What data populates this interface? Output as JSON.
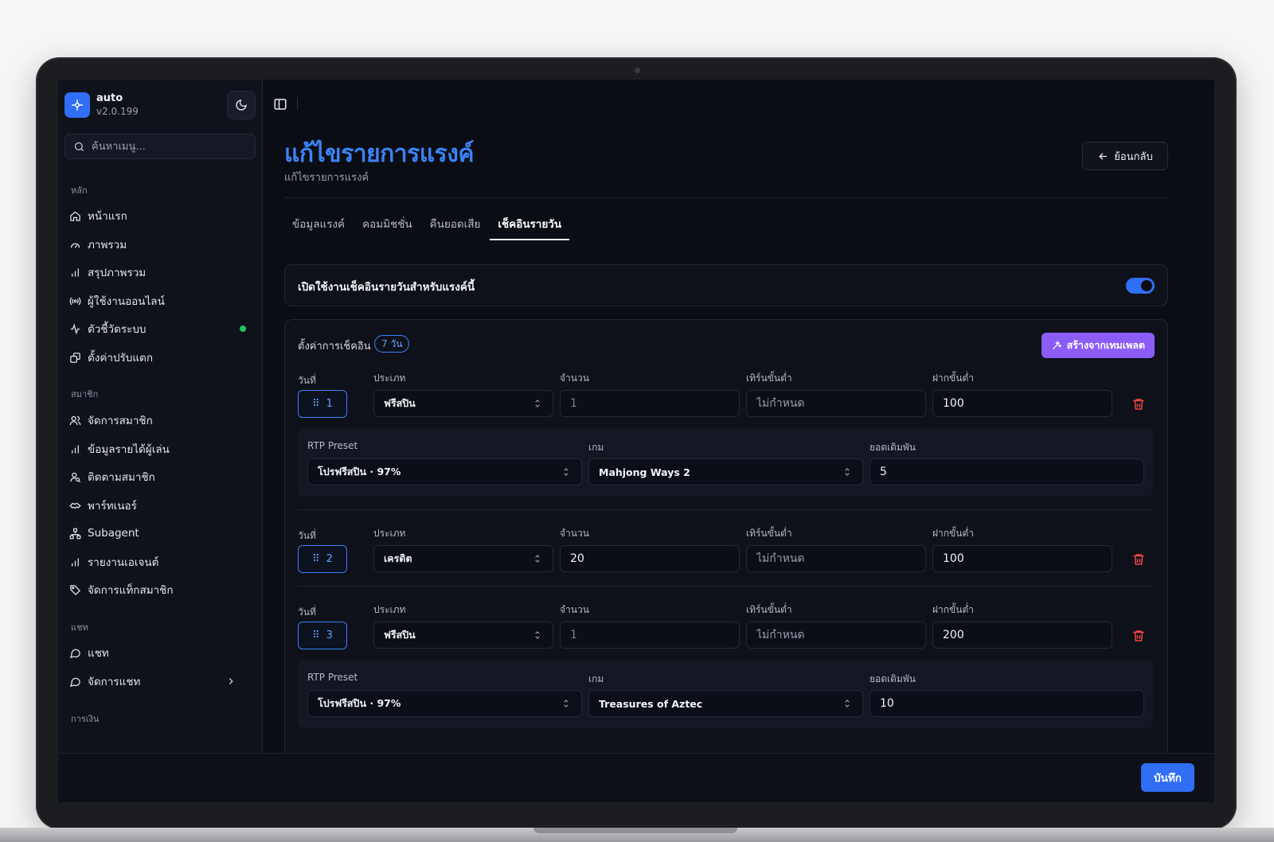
{
  "app": {
    "name": "auto",
    "version": "v2.0.199"
  },
  "sidebar": {
    "search_placeholder": "ค้นหาเมนู...",
    "sections": {
      "main": "หลัก",
      "members": "สมาชิก",
      "chat": "แชท",
      "finance": "การเงิน"
    },
    "main_items": [
      "หน้าแรก",
      "ภาพรวม",
      "สรุปภาพรวม",
      "ผู้ใช้งานออนไลน์",
      "ตัวชี้วัดระบบ",
      "ตั้งค่าปรับแตก"
    ],
    "member_items": [
      "จัดการสมาชิก",
      "ข้อมูลรายได้ผู้เล่น",
      "ติดตามสมาชิก",
      "พาร์ทเนอร์",
      "Subagent",
      "รายงานเอเจนต์",
      "จัดการแท็กสมาชิก"
    ],
    "chat_items": [
      "แชท",
      "จัดการแชท"
    ]
  },
  "header": {
    "title": "แก้ไขรายการแรงค์",
    "subtitle": "แก้ไขรายการแรงค์",
    "back_label": "ย้อนกลับ"
  },
  "tabs": [
    "ข้อมูลแรงค์",
    "คอมมิชชั่น",
    "คืนยอดเสีย",
    "เช็คอินรายวัน"
  ],
  "active_tab": 3,
  "enable": {
    "label": "เปิดใช้งานเช็คอินรายวันสำหรับแรงค์นี้",
    "on": true
  },
  "checkin": {
    "title": "ตั้งค่าการเช็คอิน",
    "badge": "7 วัน",
    "generate_label": "สร้างจากเทมเพลต",
    "labels": {
      "day": "วันที่",
      "type": "ประเภท",
      "amount": "จำนวน",
      "min_turnover": "เทิร์นขั้นต่ำ",
      "min_deposit": "ฝากขั้นต่ำ",
      "rtp": "RTP Preset",
      "game": "เกม",
      "bet": "ยอดเดิมพัน"
    },
    "rows": [
      {
        "day": "1",
        "type": "ฟรีสปิน",
        "amount": "1",
        "turnover_placeholder": "ไม่กำหนด",
        "deposit": "100",
        "rtp": "โปรฟรีสปิน · 97%",
        "game": "Mahjong Ways 2",
        "bet": "5"
      },
      {
        "day": "2",
        "type": "เครดิต",
        "amount": "20",
        "turnover_placeholder": "ไม่กำหนด",
        "deposit": "100"
      },
      {
        "day": "3",
        "type": "ฟรีสปิน",
        "amount": "1",
        "turnover_placeholder": "ไม่กำหนด",
        "deposit": "200",
        "rtp": "โปรฟรีสปิน · 97%",
        "game": "Treasures of Aztec",
        "bet": "10"
      }
    ]
  },
  "footer": {
    "save_label": "บันทึก"
  },
  "colors": {
    "accent": "#2f6ef5",
    "title": "#3b82f6",
    "generate": "#8b5cf6",
    "danger": "#ef4444",
    "online": "#22c55e"
  }
}
